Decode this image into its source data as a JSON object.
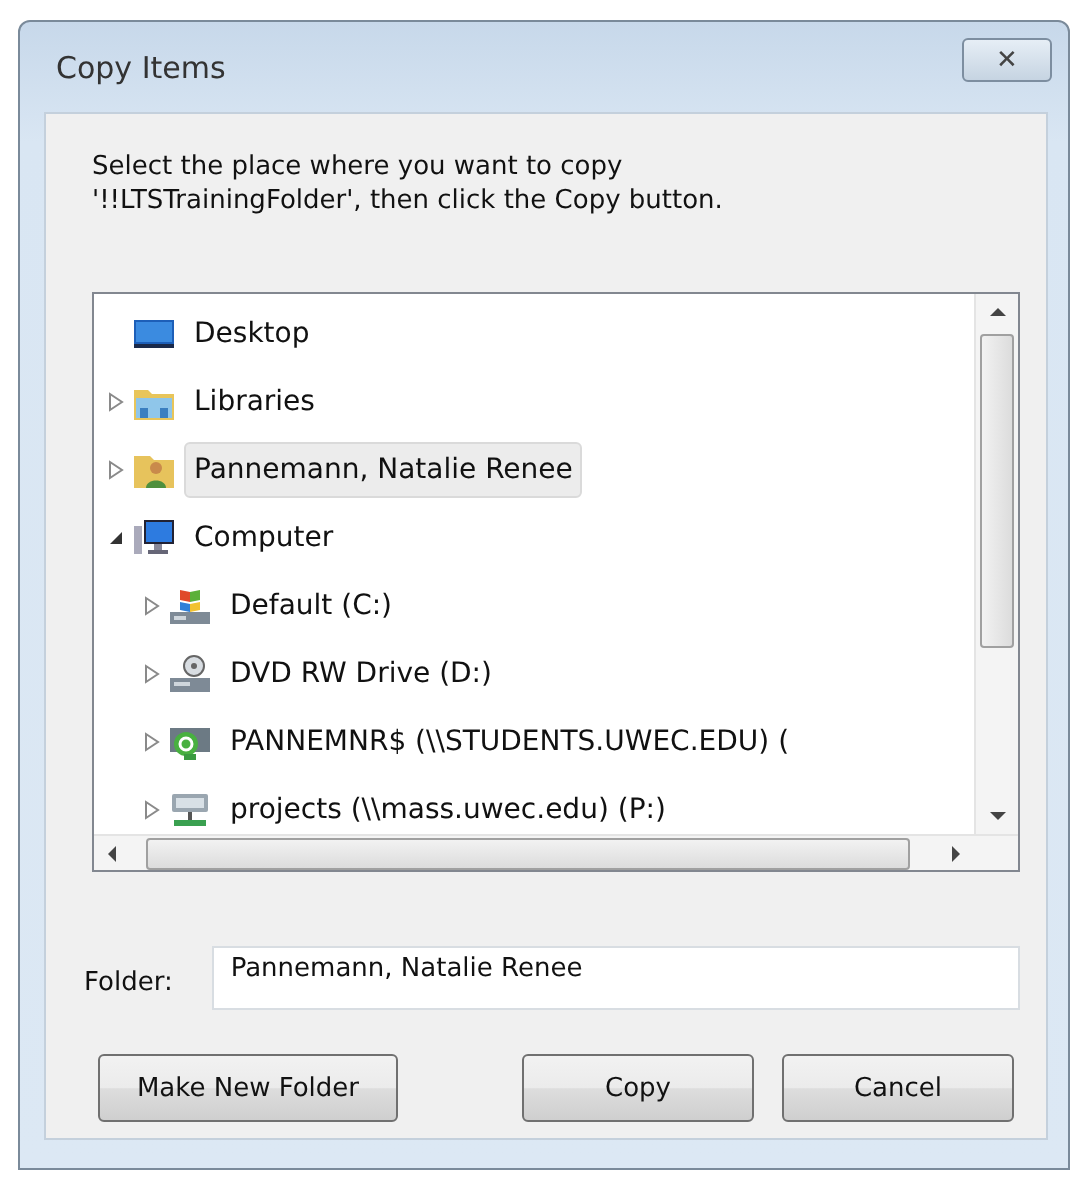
{
  "window": {
    "title": "Copy Items",
    "close": "✕"
  },
  "instruction": "Select the place where you want to copy '!!LTSTrainingFolder', then click the Copy button.",
  "tree": [
    {
      "label": "Desktop",
      "kind": "desktop",
      "selected": false,
      "children": [
        {
          "label": "Libraries",
          "kind": "library",
          "expanded": false,
          "selected": false
        },
        {
          "label": "Pannemann, Natalie Renee",
          "kind": "user",
          "expanded": false,
          "selected": true
        },
        {
          "label": "Computer",
          "kind": "computer",
          "expanded": true,
          "selected": false,
          "children": [
            {
              "label": "Default (C:)",
              "kind": "drive",
              "expanded": false,
              "selected": false
            },
            {
              "label": "DVD RW Drive (D:)",
              "kind": "dvd",
              "expanded": false,
              "selected": false
            },
            {
              "label": "PANNEMNR$ (\\\\STUDENTS.UWEC.EDU) (",
              "kind": "sync",
              "expanded": false,
              "selected": false
            },
            {
              "label": "projects (\\\\mass.uwec.edu) (P:)",
              "kind": "network",
              "expanded": false,
              "selected": false
            }
          ]
        }
      ]
    }
  ],
  "folder": {
    "label": "Folder:",
    "value": "Pannemann, Natalie Renee"
  },
  "buttons": [
    "Make New Folder",
    "Copy",
    "Cancel"
  ]
}
